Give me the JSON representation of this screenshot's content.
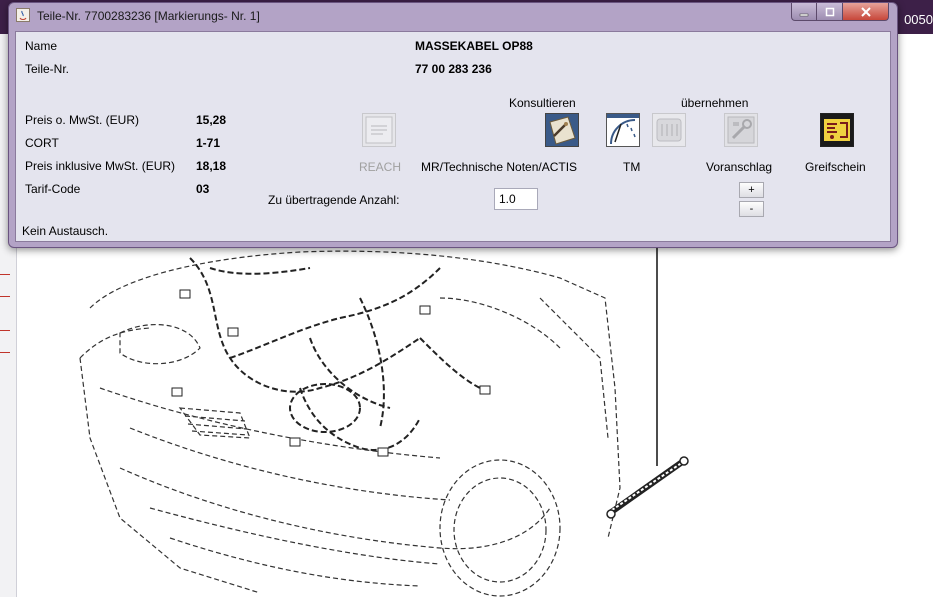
{
  "background": {
    "partial_code": "0050"
  },
  "window": {
    "title": "Teile-Nr. 7700283236 [Markierungs- Nr. 1]",
    "controls": [
      "minimize",
      "maximize",
      "close"
    ]
  },
  "fields": {
    "name_label": "Name",
    "name_value": "MASSEKABEL  OP88",
    "part_label": "Teile-Nr.",
    "part_value": "77 00 283 236",
    "price_net_label": "Preis o. MwSt. (EUR)",
    "price_net_value": "15,28",
    "cort_label": "CORT",
    "cort_value": "1-71",
    "price_gross_label": "Preis inklusive MwSt. (EUR)",
    "price_gross_value": "18,18",
    "tariff_label": "Tarif-Code",
    "tariff_value": "03"
  },
  "groups": {
    "consult": "Konsultieren",
    "adopt": "übernehmen"
  },
  "buttons": {
    "reach": "REACH",
    "mr_notes": "MR/Technische Noten/ACTIS",
    "tm": "TM",
    "quote": "Voranschlag",
    "pick": "Greifschein"
  },
  "quantity": {
    "label": "Zu übertragende Anzahl:",
    "value": "1.0",
    "plus": "+",
    "minus": "-"
  },
  "status": "Kein Austausch.",
  "colors": {
    "window_frame": "#b3a3c6",
    "panel": "#e4e4ee",
    "bg_titlebar": "#3d2048",
    "accent_red": "#c0342b"
  }
}
